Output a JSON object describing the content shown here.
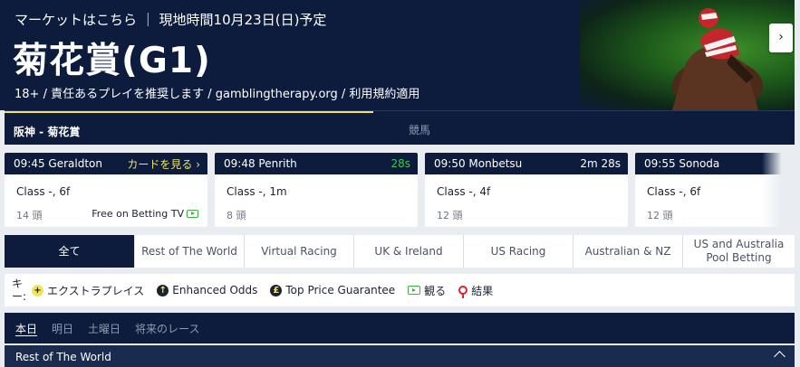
{
  "banner": {
    "market_line": "マーケットはこちら ｜ 現地時間10月23日(日)予定",
    "title": "菊花賞(G1)",
    "disclaimer": "18+ / 責任あるプレイを推奨します / gamblingtherapy.org / 利用規約適用"
  },
  "venue": {
    "name": "阪神 - 菊花賞",
    "category": "競馬"
  },
  "cards": [
    {
      "time": "09:45 Geraldton",
      "flag": "カードを見る ›",
      "class": "Class -, 6f",
      "runners": "14 頭",
      "tv": "Free on Betting TV"
    },
    {
      "time": "09:48 Penrith",
      "flag": "28s",
      "class": "Class -, 1m",
      "runners": "8 頭",
      "tv": ""
    },
    {
      "time": "09:50 Monbetsu",
      "flag": "2m 28s",
      "class": "Class -, 4f",
      "runners": "12 頭",
      "tv": ""
    },
    {
      "time": "09:55 Sonoda",
      "flag": "",
      "class": "Class -, 6f",
      "runners": "12 頭",
      "tv": ""
    }
  ],
  "next_label": "›",
  "tabs": [
    "全て",
    "Rest of The World",
    "Virtual Racing",
    "UK & Ireland",
    "US Racing",
    "Australian & NZ",
    "US and Australia Pool Betting"
  ],
  "legend": {
    "key_label": "キー:",
    "extra_place": "エクストラプレイス",
    "enhanced_odds": "Enhanced Odds",
    "top_price": "Top Price Guarantee",
    "watch": "観る",
    "result": "結果"
  },
  "days": [
    "本日",
    "明日",
    "土曜日",
    "将来のレース"
  ],
  "section": {
    "title": "Rest of The World"
  },
  "colors": {
    "navy": "#0d1c3d",
    "accent_yellow": "#f1e45a",
    "countdown_green": "#3cc94a"
  }
}
